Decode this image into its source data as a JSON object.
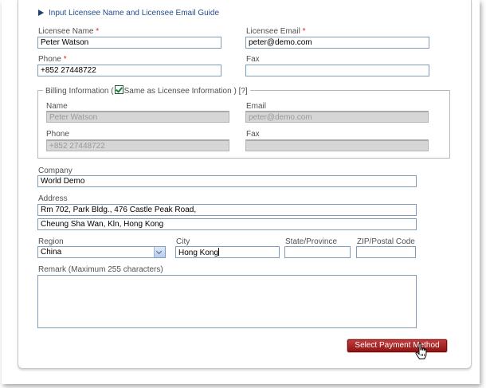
{
  "guide_link": "Input Licensee Name and Licensee Email Guide",
  "licensee": {
    "name_label": "Licensee Name",
    "name_value": "Peter Watson",
    "email_label": "Licensee Email",
    "email_value": "peter@demo.com",
    "phone_label": "Phone",
    "phone_value": "+852 27448722",
    "fax_label": "Fax",
    "fax_value": "",
    "required_mark": "*"
  },
  "billing": {
    "legend_prefix": "Billing Information (",
    "legend_checkbox_label": "Same as Licensee Information )",
    "legend_help": "[?]",
    "same_as_licensee": true,
    "name_label": "Name",
    "name_value": "Peter Watson",
    "email_label": "Email",
    "email_value": "peter@demo.com",
    "phone_label": "Phone",
    "phone_value": "+852 27448722",
    "fax_label": "Fax",
    "fax_value": ""
  },
  "company": {
    "label": "Company",
    "value": "World Demo"
  },
  "address": {
    "label": "Address",
    "line1": "Rm 702, Park Bldg., 476 Castle Peak Road,",
    "line2": "Cheung Sha Wan, Kln, Hong Kong"
  },
  "region": {
    "label": "Region",
    "selected": "China"
  },
  "city": {
    "label": "City",
    "value": "Hong Kong"
  },
  "state": {
    "label": "State/Province",
    "value": ""
  },
  "zip": {
    "label": "ZIP/Postal Code",
    "value": ""
  },
  "remark": {
    "label": "Remark (Maximum 255 characters)",
    "value": ""
  },
  "submit_button": "Select Payment Method",
  "colors": {
    "button": "#a52424",
    "link": "#1f4e8c",
    "required": "#d21f1f"
  }
}
